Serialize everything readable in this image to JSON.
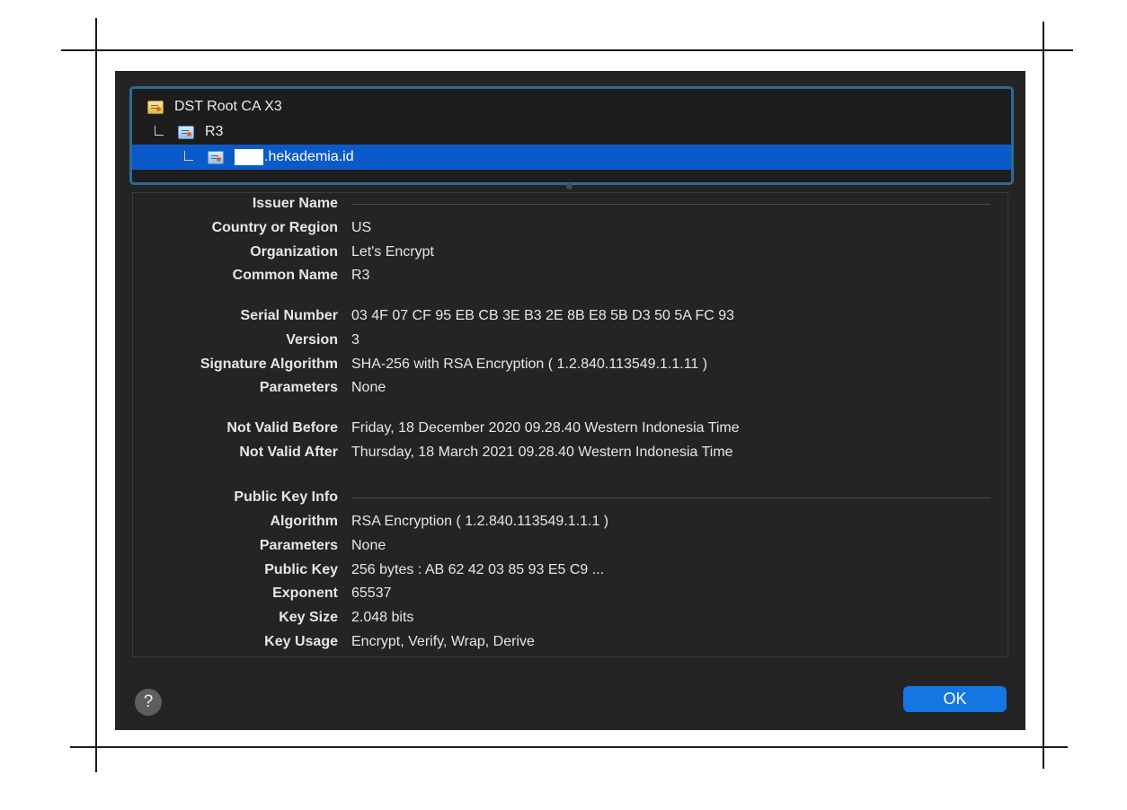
{
  "tree": {
    "items": [
      {
        "label": "DST Root CA X3"
      },
      {
        "label": "R3"
      },
      {
        "label": ".hekademia.id"
      }
    ]
  },
  "details": {
    "issuer_header": "Issuer Name",
    "country_label": "Country or Region",
    "country_value": "US",
    "org_label": "Organization",
    "org_value": "Let's Encrypt",
    "cn_label": "Common Name",
    "cn_value": "R3",
    "serial_label": "Serial Number",
    "serial_value": "03 4F 07 CF 95 EB CB 3E B3 2E 8B E8 5B D3 50 5A FC 93",
    "version_label": "Version",
    "version_value": "3",
    "sigalg_label": "Signature Algorithm",
    "sigalg_value": "SHA-256 with RSA Encryption ( 1.2.840.113549.1.1.11 )",
    "params1_label": "Parameters",
    "params1_value": "None",
    "nvb_label": "Not Valid Before",
    "nvb_value": "Friday, 18 December 2020 09.28.40 Western Indonesia Time",
    "nva_label": "Not Valid After",
    "nva_value": "Thursday, 18 March 2021 09.28.40 Western Indonesia Time",
    "pki_header": "Public Key Info",
    "alg_label": "Algorithm",
    "alg_value": "RSA Encryption ( 1.2.840.113549.1.1.1 )",
    "params2_label": "Parameters",
    "params2_value": "None",
    "pk_label": "Public Key",
    "pk_value": "256 bytes : AB 62 42 03 85 93 E5 C9 ...",
    "exp_label": "Exponent",
    "exp_value": "65537",
    "keysize_label": "Key Size",
    "keysize_value": "2.048 bits",
    "usage_label": "Key Usage",
    "usage_value": "Encrypt, Verify, Wrap, Derive"
  },
  "buttons": {
    "help_label": "?",
    "ok_label": "OK"
  },
  "colors": {
    "selection": "#0b5ac9",
    "ok_button": "#1475e3",
    "tree_border": "#2e6a95"
  },
  "icons": [
    "certificate-icon",
    "help-icon"
  ]
}
